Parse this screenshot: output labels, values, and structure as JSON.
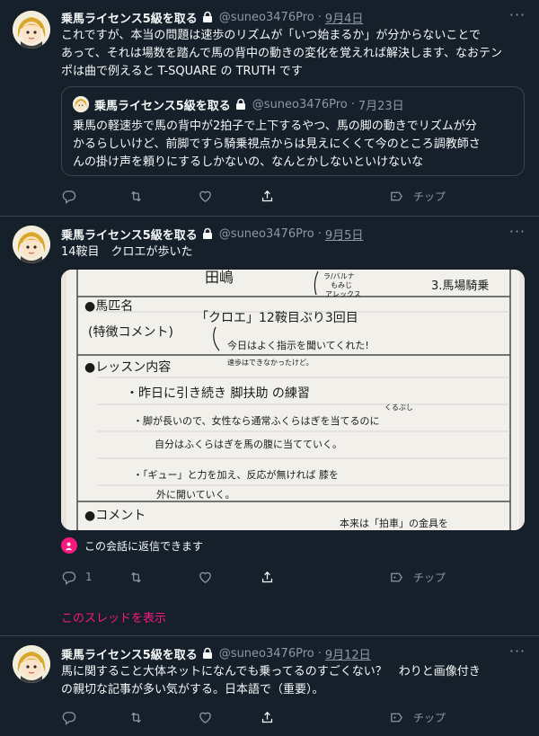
{
  "author": {
    "name": "乗馬ライセンス5級を取る",
    "handle": "@suneo3476Pro"
  },
  "tweets": [
    {
      "date": "9月4日",
      "text_lines": [
        "これですが、本当の問題は速歩のリズムが「いつ始まるか」が分からないことで",
        "あって、それは場数を踏んで馬の背中の動きの変化を覚えれば解決します、なおテン",
        "ポは曲で例えると T-SQUARE の TRUTH です"
      ],
      "quote": {
        "date": "7月23日",
        "text_lines": [
          "乗馬の軽速歩で馬の背中が2拍子で上下するやつ、馬の脚の動きでリズムが分",
          "かるらしいけど、前脚ですら騎乗視点からは見えにくくて今のところ調教師さ",
          "んの掛け声を頼りにするしかないの、なんとかしないといけないな"
        ]
      },
      "actions": {
        "tip": "チップ"
      }
    },
    {
      "date": "9月5日",
      "text_lines": [
        "14鞍目　クロエが歩いた"
      ],
      "photo": {
        "printed": [
          "●馬匹名",
          "(特徴コメント)",
          "●レッスン内容",
          "●コメント"
        ],
        "handwritten": [
          "田嶋",
          "ラ/バルナ",
          "もみじ",
          "アレックス",
          "3.馬場騎乗",
          "「クロエ」12鞍目ぶり3回目",
          "今日はよく指示を聞いてくれた!",
          "速歩はできなかったけど。",
          "・昨日に引き続き 脚扶助 の練習",
          "くるぶし",
          "・脚が長いので、女性なら通常ふくらはぎを当てるのに",
          "自分はふくらはぎを馬の腹に当てていく。",
          "・「ギュー」と力を加え、反応が無ければ 膝を",
          "外に開いていく。",
          "本来は「拍車」の金具を"
        ]
      },
      "reply_note": "この会話に返信できます",
      "actions": {
        "reply_count": "1",
        "tip": "チップ"
      },
      "thread_link": "このスレッドを表示"
    },
    {
      "date": "9月12日",
      "text_lines": [
        "馬に関すること大体ネットになんでも乗ってるのすごくない？　わりと画像付き",
        "の親切な記事が多い気がする。日本語で（重要）。"
      ],
      "actions": {
        "tip": "チップ"
      }
    }
  ],
  "colors": {
    "background": "#15202b",
    "border": "#38444d",
    "secondary_text": "#8b98a5",
    "accent_pink": "#f91880"
  },
  "icons": [
    "lock-icon",
    "more-icon",
    "reply-icon",
    "retweet-icon",
    "like-icon",
    "share-icon",
    "tip-icon"
  ]
}
